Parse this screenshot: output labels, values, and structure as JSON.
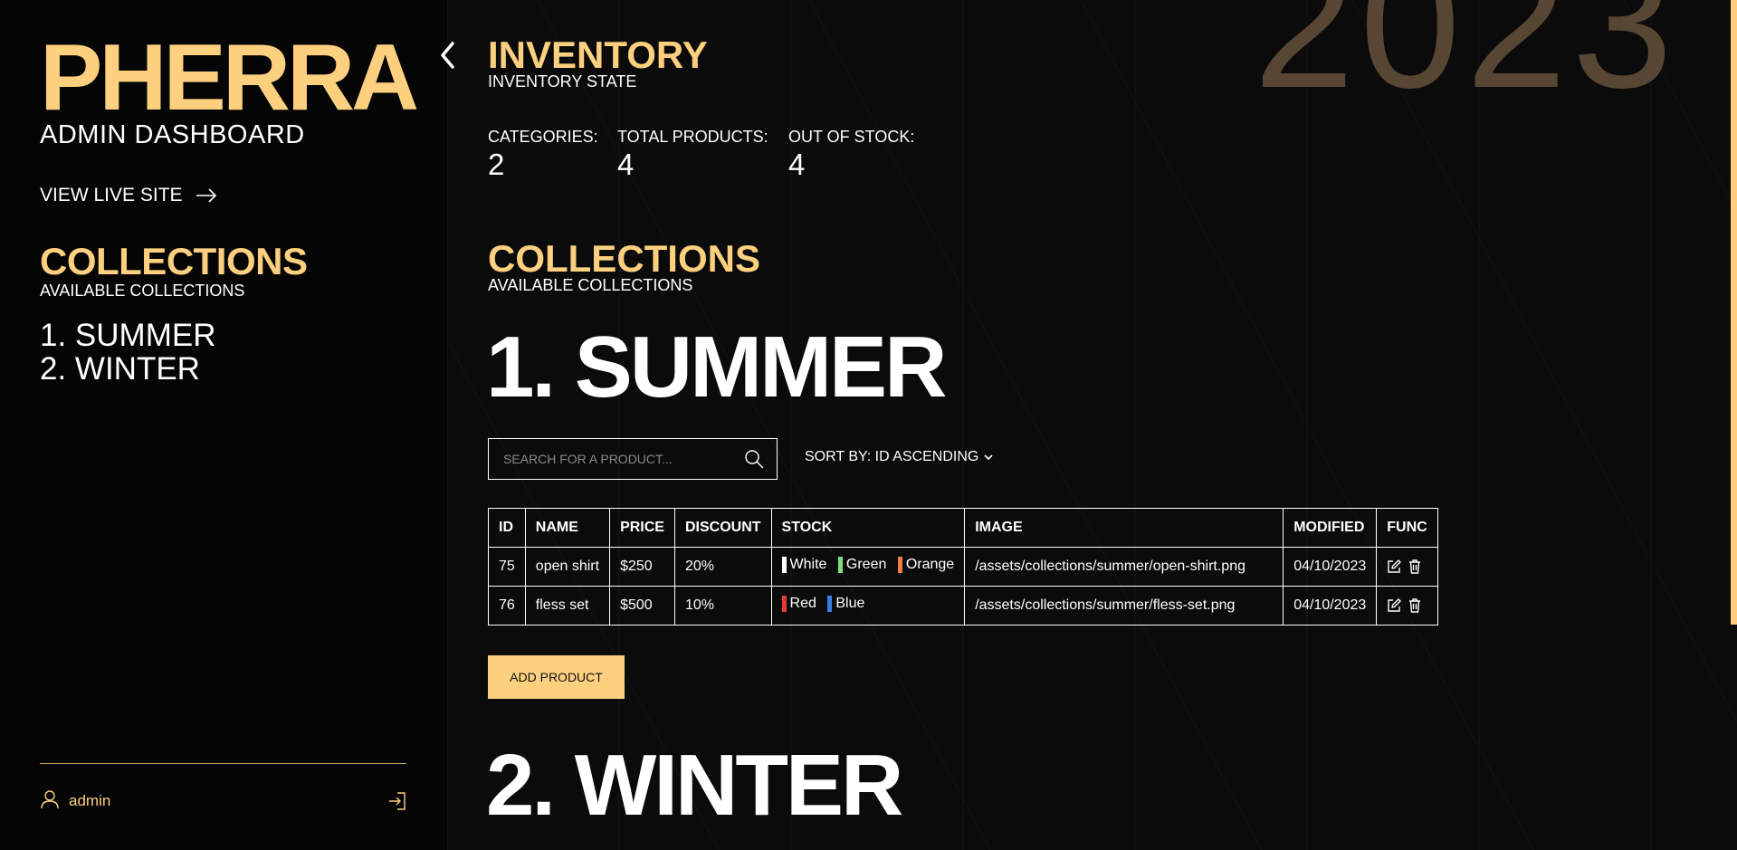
{
  "brand": {
    "title": "PHERRA",
    "subtitle": "ADMIN DASHBOARD"
  },
  "sidebar": {
    "live_site_label": "VIEW LIVE SITE",
    "collections_title": "COLLECTIONS",
    "collections_subtitle": "AVAILABLE COLLECTIONS",
    "collections": [
      {
        "label": "1. SUMMER"
      },
      {
        "label": "2. WINTER"
      }
    ],
    "user_name": "admin"
  },
  "background": {
    "year": "2023"
  },
  "inventory": {
    "title": "INVENTORY",
    "subtitle": "INVENTORY STATE",
    "stats": [
      {
        "label": "CATEGORIES:",
        "value": "2"
      },
      {
        "label": "TOTAL PRODUCTS:",
        "value": "4"
      },
      {
        "label": "OUT OF STOCK:",
        "value": "4"
      }
    ]
  },
  "collections": {
    "title": "COLLECTIONS",
    "subtitle": "AVAILABLE COLLECTIONS",
    "sections": [
      {
        "heading": "1. SUMMER",
        "search_placeholder": "SEARCH FOR A PRODUCT...",
        "sort_label": "SORT BY: ID ASCENDING",
        "columns": [
          "ID",
          "NAME",
          "PRICE",
          "DISCOUNT",
          "STOCK",
          "IMAGE",
          "MODIFIED",
          "FUNC"
        ],
        "rows": [
          {
            "id": "75",
            "name": "open shirt",
            "price": "$250",
            "discount": "20%",
            "stock": [
              {
                "label": "White",
                "color": "#ffffff"
              },
              {
                "label": "Green",
                "color": "#7dde7a"
              },
              {
                "label": "Orange",
                "color": "#ef7d45"
              }
            ],
            "image": "/assets/collections/summer/open-shirt.png",
            "modified": "04/10/2023"
          },
          {
            "id": "76",
            "name": "fless set",
            "price": "$500",
            "discount": "10%",
            "stock": [
              {
                "label": "Red",
                "color": "#e23a3a"
              },
              {
                "label": "Blue",
                "color": "#3a7de6"
              }
            ],
            "image": "/assets/collections/summer/fless-set.png",
            "modified": "04/10/2023"
          }
        ],
        "add_button_label": "ADD PRODUCT"
      },
      {
        "heading": "2. WINTER"
      }
    ]
  },
  "colors": {
    "accent": "#fdd07f",
    "background": "#0b0b0b",
    "sidebar": "#050505"
  },
  "icons": {
    "back": "chevron-left-icon",
    "live_site": "arrow-right-icon",
    "search": "search-icon",
    "sort": "chevron-down-icon",
    "user": "user-icon",
    "logout": "logout-icon",
    "edit": "edit-icon",
    "delete": "trash-icon"
  }
}
